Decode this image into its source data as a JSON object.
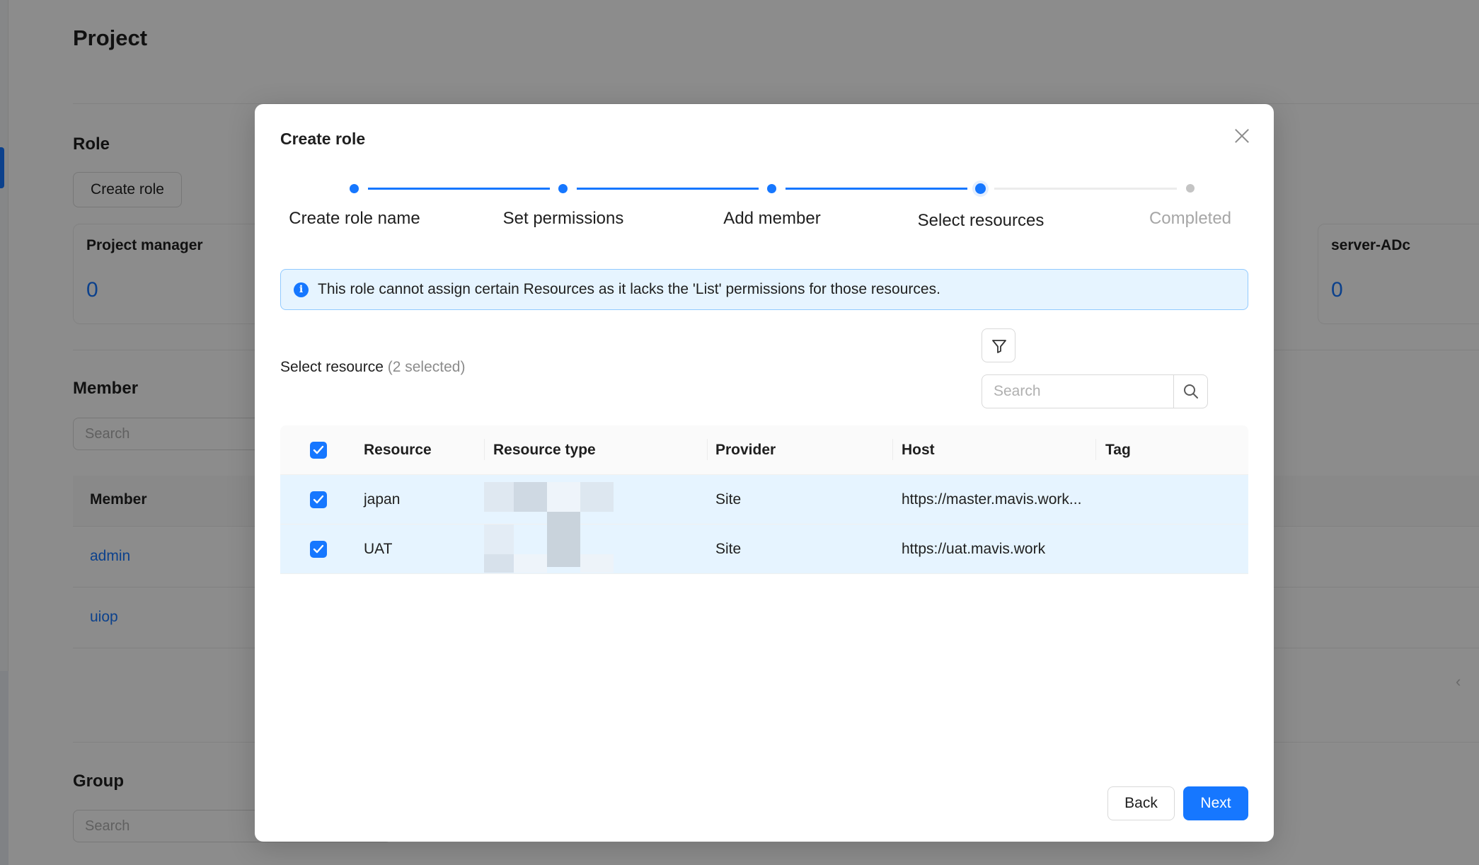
{
  "background": {
    "page_title": "Project",
    "role_section_title": "Role",
    "create_role_button": "Create role",
    "role_cards": [
      {
        "name": "Project manager",
        "count": "0"
      },
      {
        "name": "server-ADc",
        "count": "0"
      }
    ],
    "member_section_title": "Member",
    "member_search_placeholder": "Search",
    "member_column_header": "Member",
    "members": [
      "admin",
      "uiop"
    ],
    "group_section_title": "Group",
    "group_search_placeholder": "Search"
  },
  "modal": {
    "title": "Create role",
    "steps": [
      {
        "label": "Create role name",
        "status": "done"
      },
      {
        "label": "Set permissions",
        "status": "done"
      },
      {
        "label": "Add member",
        "status": "done"
      },
      {
        "label": "Select resources",
        "status": "current"
      },
      {
        "label": "Completed",
        "status": "pending"
      }
    ],
    "alert_text": "This role cannot assign certain Resources as it lacks the 'List' permissions for those resources.",
    "select_resource_label": "Select resource",
    "selected_count_text": "(2 selected)",
    "search_placeholder": "Search",
    "table": {
      "columns": [
        "Resource",
        "Resource type",
        "Provider",
        "Host",
        "Tag"
      ],
      "rows": [
        {
          "resource": "japan",
          "resource_type": "",
          "provider": "Site",
          "host": "https://master.mavis.work...",
          "tag": "",
          "checked": true
        },
        {
          "resource": "UAT",
          "resource_type": "",
          "provider": "Site",
          "host": "https://uat.mavis.work",
          "tag": "",
          "checked": true
        }
      ]
    },
    "back_button": "Back",
    "next_button": "Next"
  },
  "colors": {
    "accent": "#1677ff",
    "selected_row_bg": "#e6f4ff",
    "alert_border": "#91caff"
  },
  "icons": [
    "close-icon",
    "info-icon",
    "filter-icon",
    "search-icon",
    "check-icon"
  ]
}
